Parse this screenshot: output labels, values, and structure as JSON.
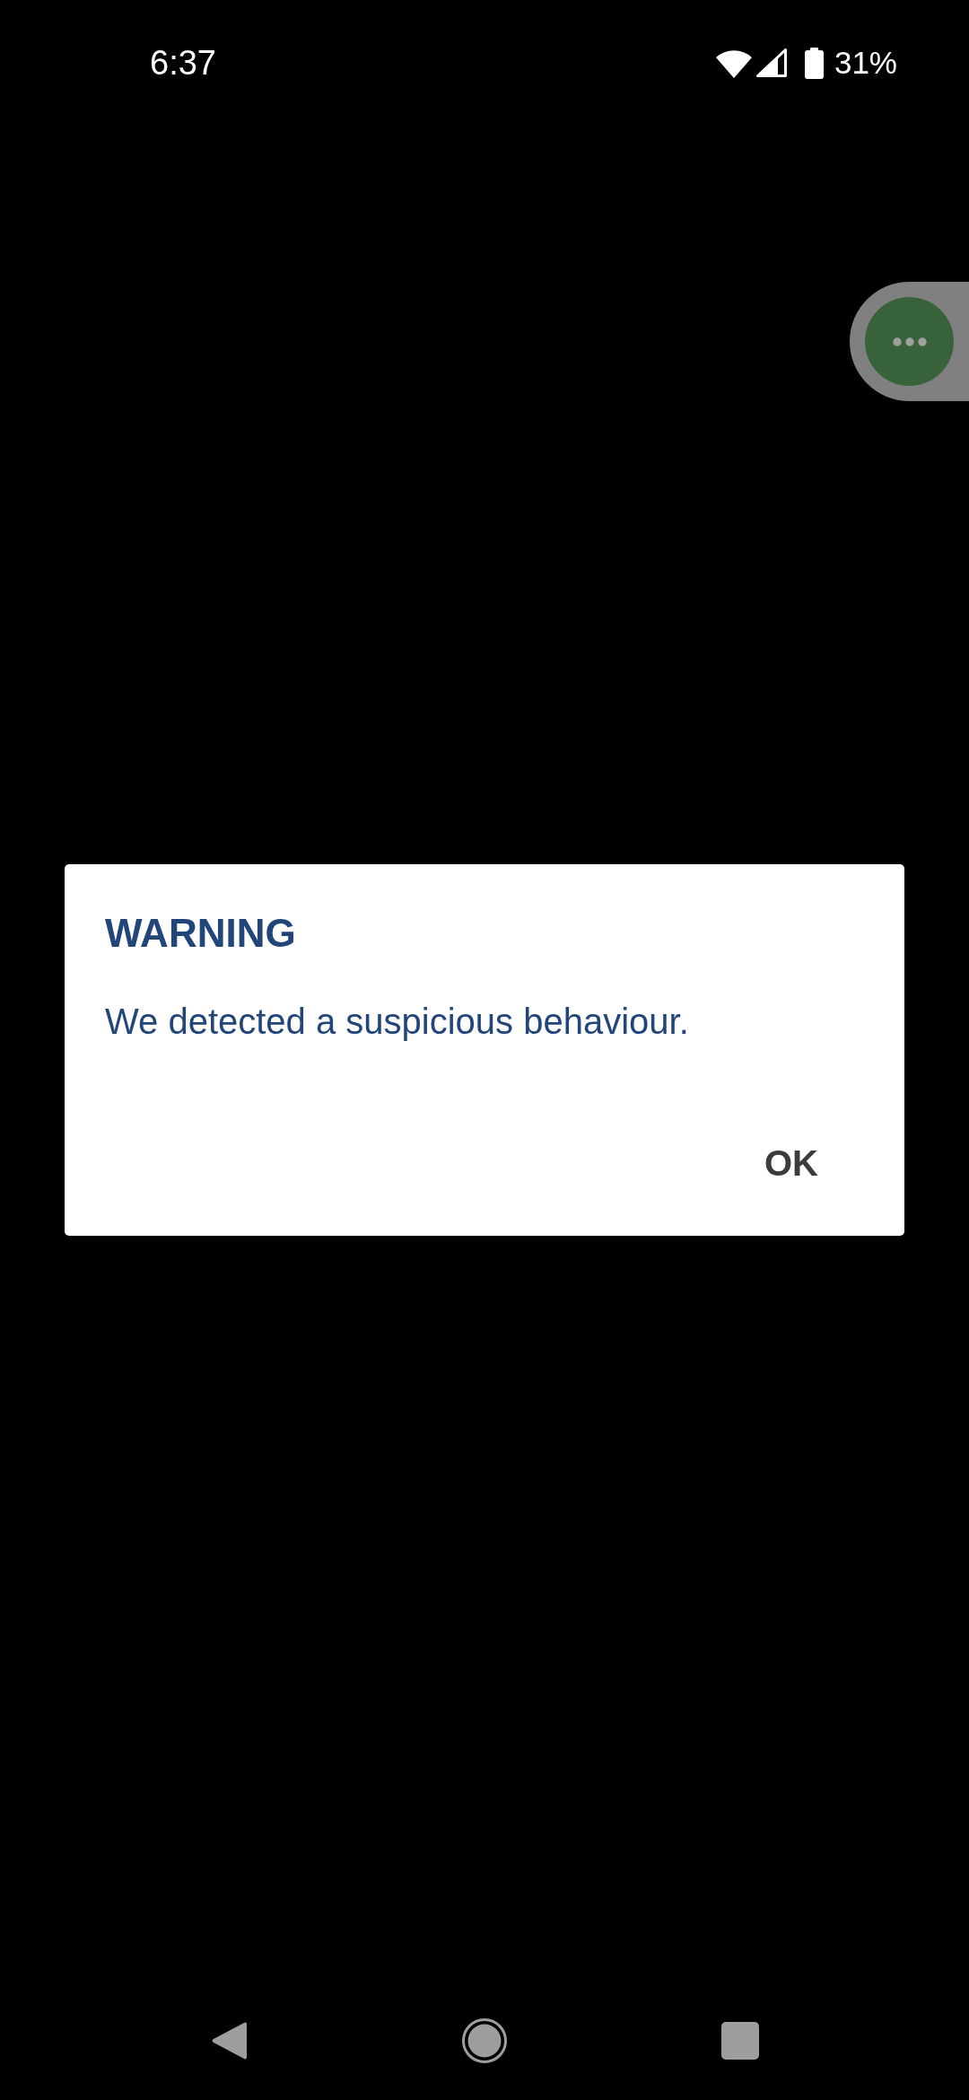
{
  "status_bar": {
    "time": "6:37",
    "battery": "31%"
  },
  "dialog": {
    "title": "WARNING",
    "message": "We detected a suspicious behaviour.",
    "buttons": [
      "OK"
    ]
  }
}
